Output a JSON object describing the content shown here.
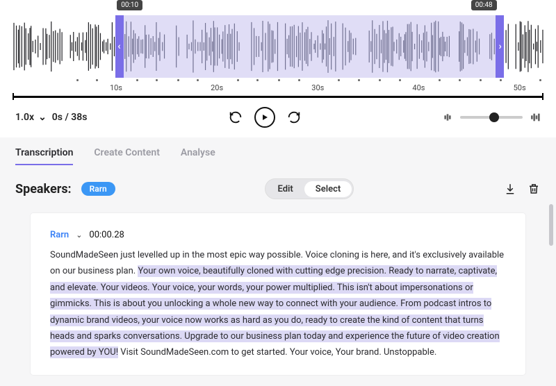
{
  "waveform": {
    "selection_start_label": "00:10",
    "selection_end_label": "00:48",
    "selection_start_pct": 19.4,
    "selection_end_pct": 92.5,
    "ticks": [
      {
        "pos_pct": 19.5,
        "label": "10s"
      },
      {
        "pos_pct": 38.5,
        "label": "20s"
      },
      {
        "pos_pct": 57.5,
        "label": "30s"
      },
      {
        "pos_pct": 76.5,
        "label": "40s"
      },
      {
        "pos_pct": 95.5,
        "label": "50s"
      }
    ]
  },
  "controls": {
    "speed": "1.0x",
    "position": "0s / 38s",
    "volume_pct": 55
  },
  "tabs": {
    "items": [
      {
        "label": "Transcription",
        "active": true
      },
      {
        "label": "Create Content",
        "active": false
      },
      {
        "label": "Analyse",
        "active": false
      }
    ]
  },
  "speakers": {
    "label": "Speakers:",
    "chips": [
      "Rarn"
    ],
    "toggle": {
      "options": [
        "Edit",
        "Select"
      ],
      "selected": "Select"
    }
  },
  "transcript": {
    "speaker": "Rarn",
    "timestamp": "00:00.28",
    "text_pre": "SoundMadeSeen just levelled up in the most epic way possible. Voice cloning is here, and it's exclusively available on our business plan. ",
    "text_highlight": "Your own voice, beautifully cloned with cutting edge precision. Ready to narrate, captivate, and elevate. Your videos. Your voice, your words, your power multiplied. This isn't about impersonations or gimmicks. This is about you unlocking a whole new way to connect with your audience. From podcast intros to dynamic brand videos, your voice now works as hard as you do, ready to create the kind of content that turns heads and sparks conversations. Upgrade to our business plan today and experience the future of video creation powered by YOU!",
    "text_post": " Visit SoundMadeSeen.com to get started. Your voice, Your brand. Unstoppable."
  },
  "icons": {
    "chevron_down": "⌄",
    "handle_left": "‹",
    "handle_right": "›"
  }
}
